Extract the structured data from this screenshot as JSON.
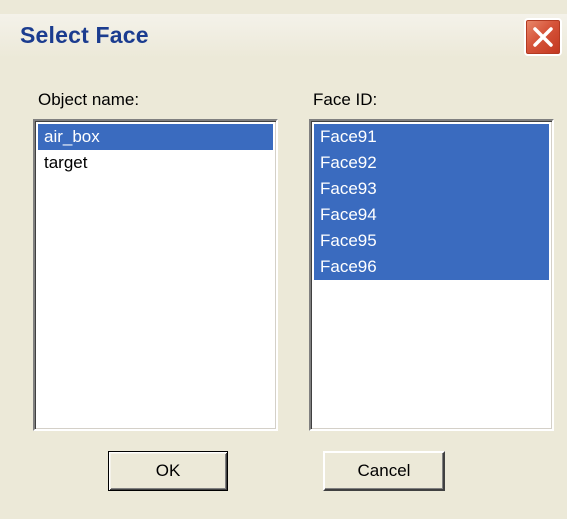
{
  "dialog": {
    "title": "Select Face",
    "close_icon": "close-x-icon"
  },
  "object_panel": {
    "label": "Object name:",
    "items": [
      {
        "label": "air_box",
        "selected": true
      },
      {
        "label": "target",
        "selected": false
      }
    ]
  },
  "face_panel": {
    "label": "Face ID:",
    "items": [
      {
        "label": "Face91",
        "selected": true
      },
      {
        "label": "Face92",
        "selected": true
      },
      {
        "label": "Face93",
        "selected": true
      },
      {
        "label": "Face94",
        "selected": true
      },
      {
        "label": "Face95",
        "selected": true
      },
      {
        "label": "Face96",
        "selected": true
      }
    ]
  },
  "buttons": {
    "ok_label": "OK",
    "cancel_label": "Cancel"
  },
  "colors": {
    "title_text": "#1b3c8f",
    "selection": "#3a6bbf",
    "close_button": "#d6543a",
    "dialog_background": "#ece9d8"
  }
}
